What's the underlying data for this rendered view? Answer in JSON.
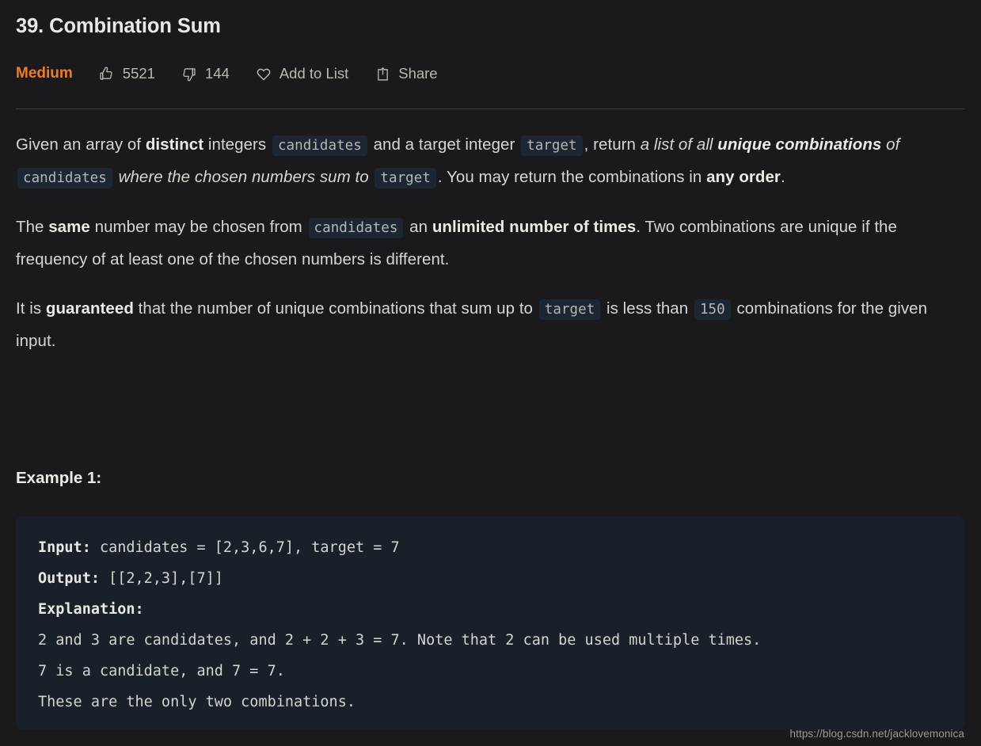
{
  "problem": {
    "title": "39. Combination Sum",
    "difficulty": "Medium",
    "difficulty_color": "#ef7c22"
  },
  "actions": {
    "likes": "5521",
    "dislikes": "144",
    "add_to_list": "Add to List",
    "share": "Share",
    "icons": {
      "like": "thumbs-up-icon",
      "dislike": "thumbs-down-icon",
      "favorite": "heart-icon",
      "share": "share-icon"
    }
  },
  "description": {
    "p1": {
      "t1": "Given an array of ",
      "b1": "distinct",
      "t2": " integers ",
      "c1": "candidates",
      "t3": " and a target integer ",
      "c2": "target",
      "t4": ", return ",
      "i1": "a list of all ",
      "ib1": "unique combinations",
      "i2": " of ",
      "c3": "candidates",
      "i3": " where the chosen numbers sum to ",
      "c4": "target",
      "t5": ". You may return the combinations in ",
      "b2": "any order",
      "t6": "."
    },
    "p2": {
      "t1": "The ",
      "b1": "same",
      "t2": " number may be chosen from ",
      "c1": "candidates",
      "t3": " an ",
      "b2": "unlimited number of times",
      "t4": ". Two combinations are unique if the frequency of at least one of the chosen numbers is different."
    },
    "p3": {
      "t1": "It is ",
      "b1": "guaranteed",
      "t2": " that the number of unique combinations that sum up to ",
      "c1": "target",
      "t3": " is less than ",
      "c2": "150",
      "t4": " combinations for the given input."
    }
  },
  "example": {
    "heading": "Example 1:",
    "lines": [
      {
        "label": "Input:",
        "text": " candidates = [2,3,6,7], target = 7"
      },
      {
        "label": "Output:",
        "text": " [[2,2,3],[7]]"
      },
      {
        "label": "Explanation:",
        "text": ""
      },
      {
        "label": "",
        "text": "2 and 3 are candidates, and 2 + 2 + 3 = 7. Note that 2 can be used multiple times."
      },
      {
        "label": "",
        "text": "7 is a candidate, and 7 = 7."
      },
      {
        "label": "",
        "text": "These are the only two combinations."
      }
    ]
  },
  "watermark": "https://blog.csdn.net/jacklovemonica",
  "theme": {
    "page_background": "#1a1a1c",
    "code_background": "#192029",
    "inline_code_background": "#1c2733",
    "text_color": "#d6d6d2",
    "divider": "#3b3b3d"
  }
}
